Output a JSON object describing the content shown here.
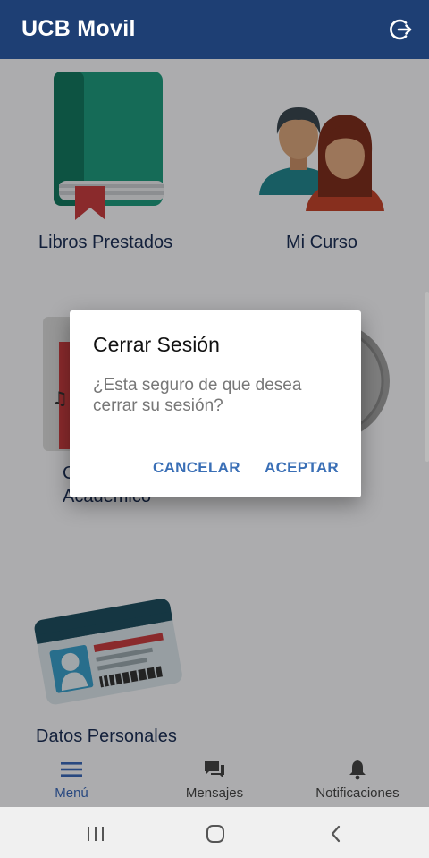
{
  "app": {
    "title": "UCB Movil"
  },
  "menu": {
    "tiles": [
      {
        "label": "Libros Prestados"
      },
      {
        "label": "Mi Curso"
      },
      {
        "label": "C"
      },
      {
        "label": "Académico"
      },
      {
        "label": "Datos Personales"
      }
    ]
  },
  "nav": {
    "items": [
      {
        "label": "Menú",
        "icon": "menu-icon",
        "active": true
      },
      {
        "label": "Mensajes",
        "icon": "chat-icon",
        "active": false
      },
      {
        "label": "Notificaciones",
        "icon": "bell-icon",
        "active": false
      }
    ]
  },
  "dialog": {
    "title": "Cerrar Sesión",
    "message": "¿Esta seguro de que desea cerrar su sesión?",
    "cancel_label": "CANCELAR",
    "accept_label": "ACEPTAR"
  },
  "colors": {
    "appbar": "#1e3f74",
    "accent": "#3a6fb6"
  }
}
